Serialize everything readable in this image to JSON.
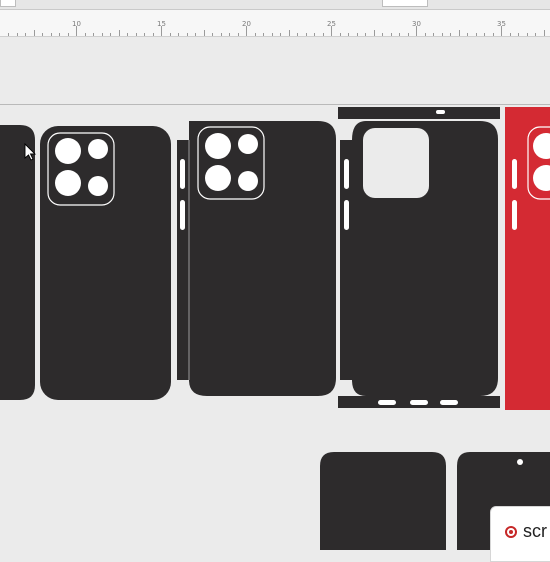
{
  "ruler": {
    "labels": [
      "10",
      "15",
      "20",
      "25",
      "30",
      "35"
    ]
  },
  "colors": {
    "skin_dark": "#2d2b2c",
    "skin_red": "#d42a33",
    "outline": "#ffffff",
    "canvas": "#ebebeb"
  },
  "icons": {
    "cursor": "mouse-pointer-icon",
    "record": "record-icon"
  },
  "branding": {
    "text": "scr"
  }
}
